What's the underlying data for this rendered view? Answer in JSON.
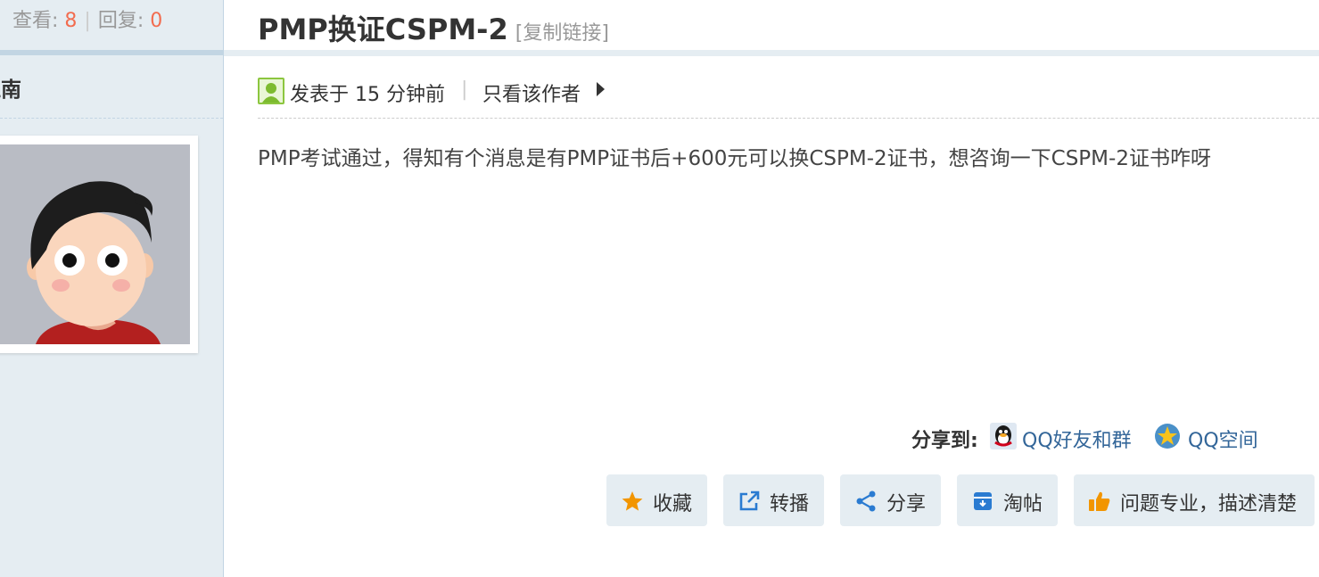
{
  "sidebar": {
    "views_label": "查看:",
    "views_count": "8",
    "replies_label": "回复:",
    "replies_count": "0",
    "author_name": "江南"
  },
  "thread": {
    "title": "PMP换证CSPM-2",
    "copy_link": "[复制链接]"
  },
  "post": {
    "posted": "发表于 15 分钟前",
    "divider": "|",
    "only_author": "只看该作者",
    "content": "PMP考试通过，得知有个消息是有PMP证书后+600元可以换CSPM-2证书，想咨询一下CSPM-2证书咋呀"
  },
  "share": {
    "label": "分享到:",
    "qq_friends": "QQ好友和群",
    "qzone": "QQ空间"
  },
  "actions": {
    "favorite": "收藏",
    "forward": "转播",
    "share": "分享",
    "taobao": "淘帖",
    "praise": "问题专业，描述清楚"
  },
  "colors": {
    "accent_number": "#f26c4f",
    "link": "#336699",
    "sidebar_bg": "#e5edf2",
    "border": "#c2d5e3"
  },
  "icons": {
    "favorite": "star-icon",
    "forward": "external-link-icon",
    "share": "share-icon",
    "taobao": "archive-icon",
    "praise": "thumbs-up-icon",
    "qq": "qq-penguin-icon",
    "qzone": "qzone-star-icon",
    "user": "user-icon"
  }
}
